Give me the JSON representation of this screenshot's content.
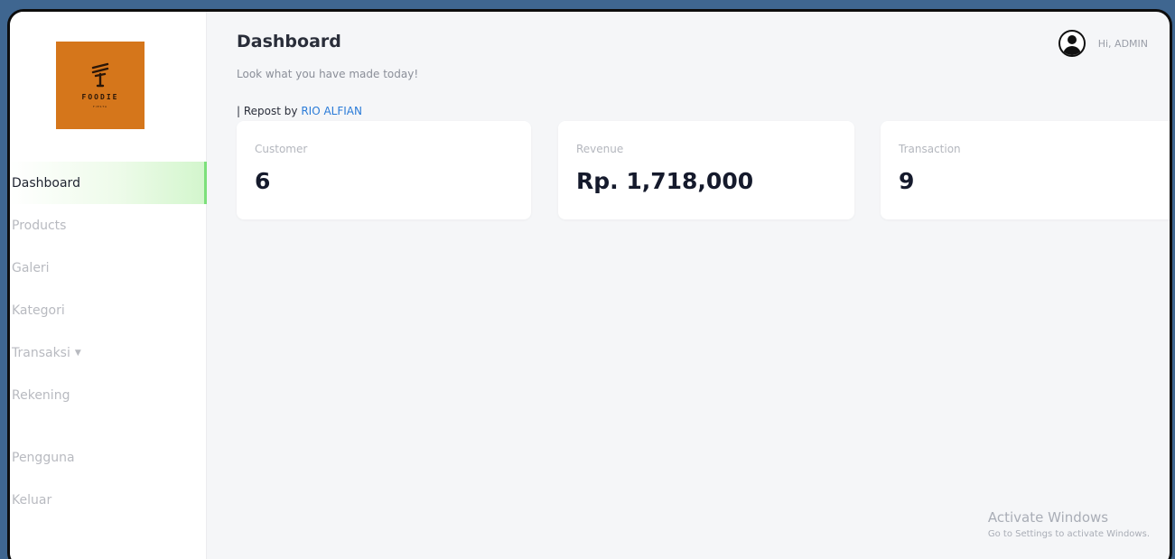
{
  "brand": {
    "name": "FOODIE",
    "tagline": "FIESTA",
    "color": "#d5761b"
  },
  "sidebar": {
    "items": [
      {
        "label": "Dashboard",
        "active": true
      },
      {
        "label": "Products",
        "active": false
      },
      {
        "label": "Galeri",
        "active": false
      },
      {
        "label": "Kategori",
        "active": false
      },
      {
        "label": "Transaksi",
        "active": false,
        "has_dropdown": true
      },
      {
        "label": "Rekening",
        "active": false
      },
      {
        "label": "Pengguna",
        "active": false
      },
      {
        "label": "Keluar",
        "active": false
      }
    ],
    "active_accent": "#7ce07b"
  },
  "header": {
    "title": "Dashboard",
    "subtitle": "Look what you have made today!",
    "repost_prefix": "| Repost by",
    "repost_author": "RIO ALFIAN",
    "user_greeting": "Hi, ADMIN",
    "user_icon": "user-circle-icon"
  },
  "stats": [
    {
      "label": "Customer",
      "value": "6"
    },
    {
      "label": "Revenue",
      "value": "Rp. 1,718,000"
    },
    {
      "label": "Transaction",
      "value": "9"
    }
  ],
  "watermark": {
    "title": "Activate Windows",
    "subtitle": "Go to Settings to activate Windows."
  }
}
